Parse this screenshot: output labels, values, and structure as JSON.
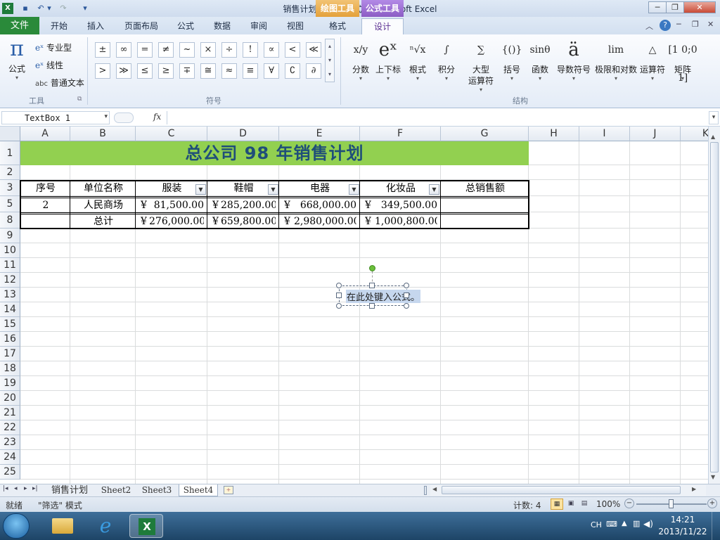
{
  "window": {
    "title": "销售计划1  [兼容模式] - Microsoft Excel"
  },
  "context_tabs": {
    "drawing": "绘图工具",
    "formula": "公式工具"
  },
  "tabs": [
    "开始",
    "插入",
    "页面布局",
    "公式",
    "数据",
    "审阅",
    "视图"
  ],
  "file_tab": "文件",
  "format_tab": "格式",
  "design_tab": "设计",
  "ribbon": {
    "tools": {
      "equation": "公式",
      "professional": "专业型",
      "linear": "线性",
      "normal_text": "普通文本",
      "normal_text_prefix": "abc",
      "label": "工具"
    },
    "symbols": {
      "row1": [
        "±",
        "∞",
        "=",
        "≠",
        "~",
        "×",
        "÷",
        "!",
        "∝",
        "<",
        "≪"
      ],
      "row2": [
        ">",
        "≫",
        "≤",
        "≥",
        "∓",
        "≅",
        "≈",
        "≡",
        "∀",
        "∁",
        "∂"
      ],
      "label": "符号"
    },
    "structures": {
      "items": [
        {
          "glyph": "x/y",
          "label": "分数"
        },
        {
          "glyph": "eˣ",
          "label": "上下标"
        },
        {
          "glyph": "ⁿ√x",
          "label": "根式"
        },
        {
          "glyph": "∫",
          "label": "积分"
        },
        {
          "glyph": "∑",
          "label": "大型\n运算符"
        },
        {
          "glyph": "{()}",
          "label": "括号"
        },
        {
          "glyph": "sinθ",
          "label": "函数"
        },
        {
          "glyph": "ä",
          "label": "导数符号"
        },
        {
          "glyph": "lim",
          "label": "极限和对数"
        },
        {
          "glyph": "△",
          "label": "运算符"
        },
        {
          "glyph": "[1 0;0 1]",
          "label": "矩阵"
        }
      ],
      "label": "结构"
    }
  },
  "name_box": "TextBox 1",
  "fx": "fx",
  "columns": [
    "A",
    "B",
    "C",
    "D",
    "E",
    "F",
    "G",
    "H",
    "I",
    "J",
    "K"
  ],
  "rows": [
    "1",
    "2",
    "3",
    "5",
    "8",
    "9",
    "10",
    "11",
    "12",
    "13",
    "14",
    "15",
    "16",
    "17",
    "18",
    "19",
    "20",
    "21",
    "22",
    "23",
    "24",
    "25"
  ],
  "sheet": {
    "title": "总公司 98 年销售计划",
    "headers": [
      "序号",
      "单位名称",
      "服装",
      "鞋帽",
      "电器",
      "化妆品",
      "总销售额"
    ],
    "row5": [
      "2",
      "人民商场",
      "¥",
      "81,500.00",
      "¥",
      "285,200.00",
      "¥",
      "668,000.00",
      "¥",
      "349,500.00"
    ],
    "row8": [
      "",
      "总计",
      "¥",
      "276,000.00",
      "¥",
      "659,800.00",
      "¥",
      "2,980,000.00",
      "¥",
      "1,000,800.00"
    ]
  },
  "textbox": {
    "placeholder": "在此处键入公式。"
  },
  "sheet_tabs": [
    "销售计划",
    "Sheet2",
    "Sheet3",
    "Sheet4"
  ],
  "status": {
    "ready": "就绪",
    "mode": "\"筛选\" 模式",
    "count": "计数: 4",
    "zoom": "100%"
  },
  "taskbar": {
    "lang": "CH",
    "time": "14:21",
    "date": "2013/11/22"
  },
  "colors": {
    "title_fill": "#92d050",
    "title_text": "#1f4e79",
    "file_tab": "#2a8a3a",
    "drawing_tab": "#e4a13a",
    "formula_tab": "#8b5cc4"
  }
}
